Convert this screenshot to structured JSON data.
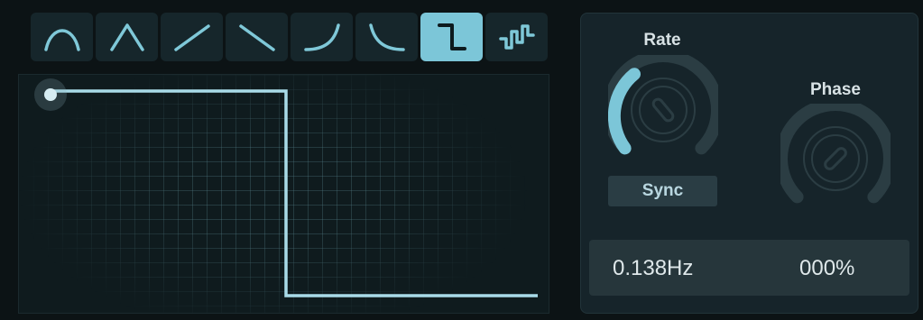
{
  "shape_selector": {
    "items": [
      {
        "icon": "arch-curve-icon"
      },
      {
        "icon": "triangle-icon"
      },
      {
        "icon": "ramp-up-icon"
      },
      {
        "icon": "ramp-down-icon"
      },
      {
        "icon": "exp-curve-up-icon"
      },
      {
        "icon": "exp-curve-down-icon"
      },
      {
        "icon": "square-step-icon",
        "selected": true
      },
      {
        "icon": "random-steps-icon"
      }
    ]
  },
  "rate": {
    "label": "Rate",
    "sync_label": "Sync",
    "value": "0.138Hz"
  },
  "phase": {
    "label": "Phase",
    "value": "000%"
  },
  "colors": {
    "accent": "#7cc6d8",
    "background": "#0c1315",
    "panel": "#16242a",
    "knob_track": "#2b3d43"
  }
}
